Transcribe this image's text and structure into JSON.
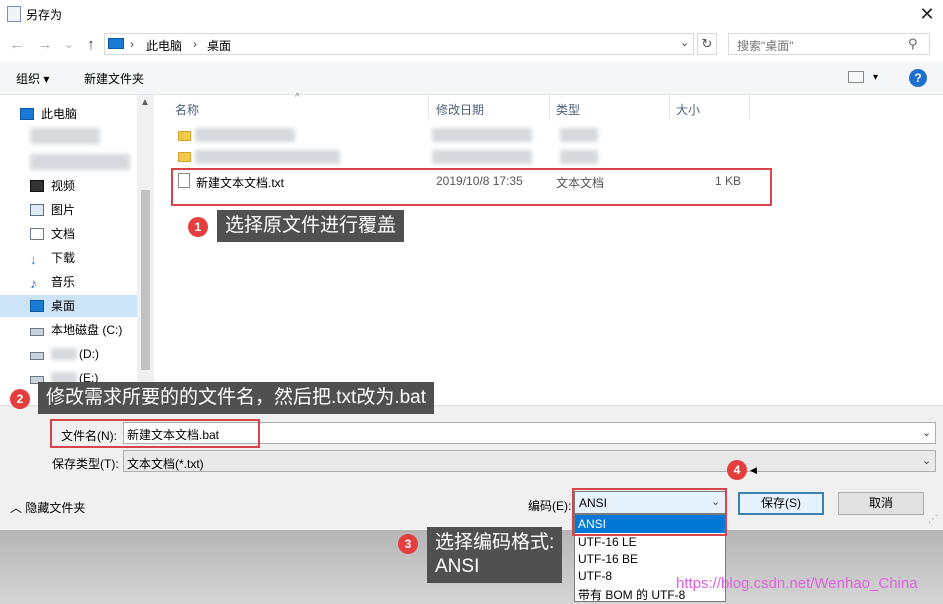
{
  "window": {
    "title": "另存为",
    "close_glyph": "✕"
  },
  "nav": {
    "back": "←",
    "forward": "→",
    "recent": "⌄",
    "up": "↑",
    "refresh": "↻"
  },
  "address": {
    "crumb_sep1": "›",
    "crumb1": "此电脑",
    "crumb_sep2": "›",
    "crumb2": "桌面",
    "dropdown": "⌄"
  },
  "search": {
    "placeholder": "搜索\"桌面\"",
    "icon": "search-icon"
  },
  "toolbar": {
    "organize": "组织 ▾",
    "new_folder": "新建文件夹",
    "view_arrow": "▾",
    "help": "?"
  },
  "sidebar": {
    "items": [
      {
        "label": "此电脑",
        "icon": "pc-icon"
      },
      {
        "label": "视频",
        "icon": "video-icon"
      },
      {
        "label": "图片",
        "icon": "picture-icon"
      },
      {
        "label": "文档",
        "icon": "document-icon"
      },
      {
        "label": "下载",
        "icon": "download-icon"
      },
      {
        "label": "音乐",
        "icon": "music-icon"
      },
      {
        "label": "桌面",
        "icon": "desktop-icon",
        "selected": true
      },
      {
        "label": "本地磁盘 (C:)",
        "icon": "drive-icon"
      },
      {
        "label": "(D:)",
        "icon": "drive-icon"
      },
      {
        "label": "(E:)",
        "icon": "drive-icon"
      }
    ]
  },
  "file_list": {
    "columns": [
      "名称",
      "修改日期",
      "类型",
      "大小"
    ],
    "sort_arrow": "^",
    "files": [
      {
        "name": "新建文本文档.txt",
        "modified": "2019/10/8 17:35",
        "type": "文本文档",
        "size": "1 KB"
      }
    ]
  },
  "annotations": [
    {
      "number": "1",
      "text": "选择原文件进行覆盖"
    },
    {
      "number": "2",
      "text": "修改需求所要的的文件名，然后把.txt改为.bat"
    },
    {
      "number": "3",
      "text_line1": "选择编码格式:",
      "text_line2": "ANSI"
    },
    {
      "number": "4"
    }
  ],
  "form": {
    "filename_label": "文件名(N):",
    "filename_value": "新建文本文档.bat",
    "filetype_label": "保存类型(T):",
    "filetype_value": "文本文档(*.txt)",
    "hide_folders": "隐藏文件夹",
    "encoding_label": "编码(E):",
    "encoding_value": "ANSI",
    "encoding_options": [
      "ANSI",
      "UTF-16 LE",
      "UTF-16 BE",
      "UTF-8",
      "带有 BOM 的 UTF-8"
    ],
    "save_button": "保存(S)",
    "cancel_button": "取消"
  },
  "watermark": "https://blog.csdn.net/Wenhao_China",
  "colors": {
    "accent": "#0078d7",
    "annotation_red": "#d9434b",
    "callout_bg": "#505050",
    "watermark": "#e060e0"
  }
}
